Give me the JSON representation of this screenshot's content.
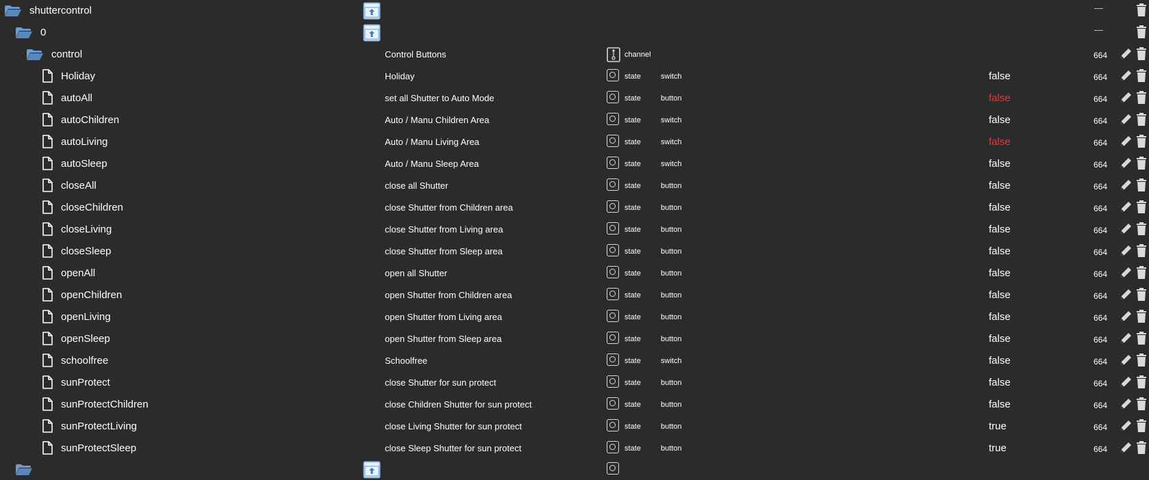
{
  "colors": {
    "background": "#2b2b2b",
    "folder": "#6b9bd1",
    "value_red": "#e53935",
    "text": "#ffffff"
  },
  "icons": {
    "folder": "folder-open-icon",
    "file": "file-icon",
    "state": "state-icon",
    "channel": "channel-icon",
    "edit": "pencil-icon",
    "delete": "trash-icon",
    "collapse": "minus-icon"
  },
  "tree": {
    "root": {
      "name": "shuttercontrol",
      "dash": "—"
    },
    "instance": {
      "name": "0",
      "dash": "—"
    },
    "channel": {
      "name": "control",
      "description": "Control Buttons",
      "type": "channel",
      "acl": "664"
    },
    "states": [
      {
        "name": "Holiday",
        "description": "Holiday",
        "type": "state",
        "role": "switch",
        "value": "false",
        "value_color": "white",
        "acl": "664"
      },
      {
        "name": "autoAll",
        "description": "set all Shutter to Auto Mode",
        "type": "state",
        "role": "button",
        "value": "false",
        "value_color": "red",
        "acl": "664"
      },
      {
        "name": "autoChildren",
        "description": "Auto / Manu Children Area",
        "type": "state",
        "role": "switch",
        "value": "false",
        "value_color": "white",
        "acl": "664"
      },
      {
        "name": "autoLiving",
        "description": "Auto / Manu Living Area",
        "type": "state",
        "role": "switch",
        "value": "false",
        "value_color": "red",
        "acl": "664"
      },
      {
        "name": "autoSleep",
        "description": "Auto / Manu Sleep Area",
        "type": "state",
        "role": "switch",
        "value": "false",
        "value_color": "white",
        "acl": "664"
      },
      {
        "name": "closeAll",
        "description": "close all Shutter",
        "type": "state",
        "role": "button",
        "value": "false",
        "value_color": "white",
        "acl": "664"
      },
      {
        "name": "closeChildren",
        "description": "close Shutter from Children area",
        "type": "state",
        "role": "button",
        "value": "false",
        "value_color": "white",
        "acl": "664"
      },
      {
        "name": "closeLiving",
        "description": "close Shutter from Living area",
        "type": "state",
        "role": "button",
        "value": "false",
        "value_color": "white",
        "acl": "664"
      },
      {
        "name": "closeSleep",
        "description": "close Shutter from Sleep area",
        "type": "state",
        "role": "button",
        "value": "false",
        "value_color": "white",
        "acl": "664"
      },
      {
        "name": "openAll",
        "description": "open all Shutter",
        "type": "state",
        "role": "button",
        "value": "false",
        "value_color": "white",
        "acl": "664"
      },
      {
        "name": "openChildren",
        "description": "open Shutter from Children area",
        "type": "state",
        "role": "button",
        "value": "false",
        "value_color": "white",
        "acl": "664"
      },
      {
        "name": "openLiving",
        "description": "open Shutter from Living area",
        "type": "state",
        "role": "button",
        "value": "false",
        "value_color": "white",
        "acl": "664"
      },
      {
        "name": "openSleep",
        "description": "open Shutter from Sleep area",
        "type": "state",
        "role": "button",
        "value": "false",
        "value_color": "white",
        "acl": "664"
      },
      {
        "name": "schoolfree",
        "description": "Schoolfree",
        "type": "state",
        "role": "switch",
        "value": "false",
        "value_color": "white",
        "acl": "664"
      },
      {
        "name": "sunProtect",
        "description": "close Shutter for sun protect",
        "type": "state",
        "role": "button",
        "value": "false",
        "value_color": "white",
        "acl": "664"
      },
      {
        "name": "sunProtectChildren",
        "description": "close Children Shutter for sun protect",
        "type": "state",
        "role": "button",
        "value": "false",
        "value_color": "white",
        "acl": "664"
      },
      {
        "name": "sunProtectLiving",
        "description": "close Living Shutter for sun protect",
        "type": "state",
        "role": "button",
        "value": "true",
        "value_color": "white",
        "acl": "664"
      },
      {
        "name": "sunProtectSleep",
        "description": "close Sleep Shutter for sun protect",
        "type": "state",
        "role": "button",
        "value": "true",
        "value_color": "white",
        "acl": "664"
      }
    ]
  }
}
